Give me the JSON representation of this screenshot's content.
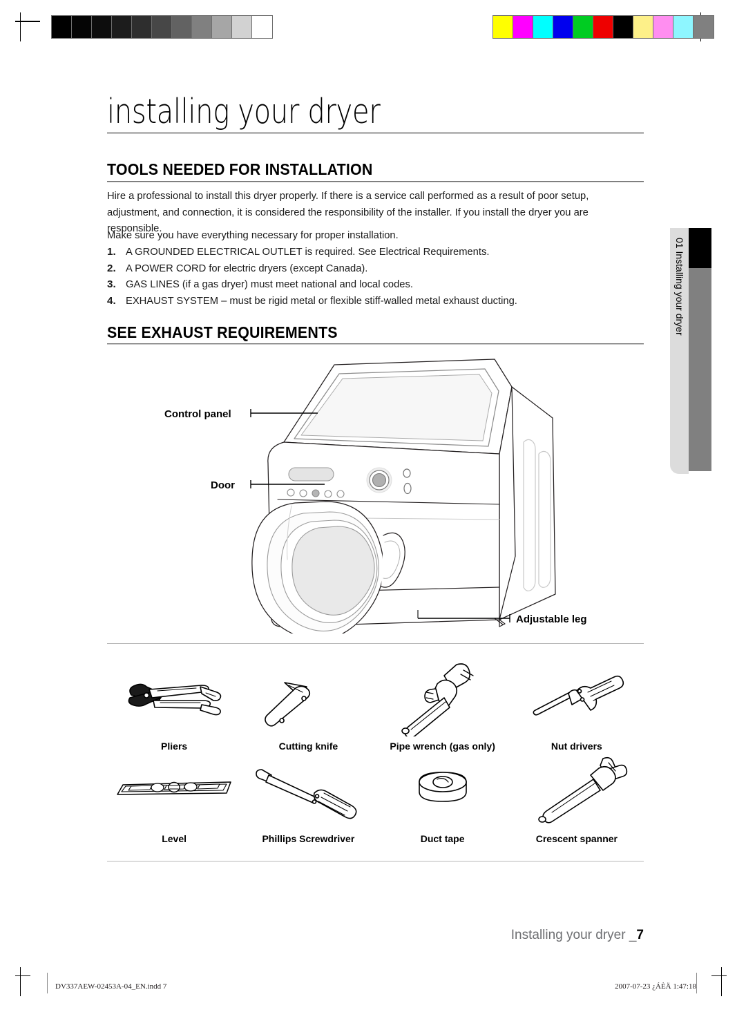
{
  "document": {
    "title": "installing your dryer"
  },
  "calibration": {
    "grayscale_label": "grayscale-calibration-bar",
    "grayscale_swatches": [
      "#000000",
      "#050505",
      "#0d0d0d",
      "#1c1c1c",
      "#2e2e2e",
      "#474747",
      "#626262",
      "#808080",
      "#a6a6a6",
      "#d2d2d2",
      "#ffffff"
    ],
    "color_label": "color-calibration-bar",
    "color_swatches": [
      "#ffff00",
      "#ff00ff",
      "#00ffff",
      "#0000ee",
      "#00cc22",
      "#ee0000",
      "#000000",
      "#fdf089",
      "#ff8ef0",
      "#8ef6ff",
      "#808080"
    ]
  },
  "sections": [
    {
      "id": "tools-needed",
      "heading": "TOOLS NEEDED FOR INSTALLATION",
      "paragraphs": [
        "Hire a professional to install this dryer properly. If there is a service call performed as a result of poor setup, adjustment, and connection, it is considered the responsibility of the installer. If you install the dryer you are responsible.",
        "Make sure you have everything necessary for proper installation."
      ],
      "list": [
        {
          "number": "1.",
          "text": "A GROUNDED ELECTRICAL OUTLET is required. See Electrical Requirements."
        },
        {
          "number": "2.",
          "text": "A POWER CORD for electric dryers (except Canada)."
        },
        {
          "number": "3.",
          "text": "GAS LINES (if a gas dryer) must meet national and local codes."
        },
        {
          "number": "4.",
          "text": "EXHAUST SYSTEM – must be rigid metal or flexible stiff-walled metal exhaust ducting."
        }
      ]
    },
    {
      "id": "see-exhaust-requirements",
      "heading": "SEE EXHAUST REQUIREMENTS"
    }
  ],
  "side_tab": {
    "label": "01 Installing your dryer",
    "black_color": "#000000",
    "gray_color": "#808080",
    "light_color": "#dcdcdc"
  },
  "figure": {
    "name": "front-load-dryer-diagram",
    "callouts": [
      {
        "id": "control-panel",
        "label": "Control panel"
      },
      {
        "id": "door",
        "label": "Door"
      },
      {
        "id": "adjustable-leg",
        "label": "Adjustable leg"
      }
    ]
  },
  "tools": [
    {
      "id": "pliers",
      "label": "Pliers"
    },
    {
      "id": "cutting-knife",
      "label": "Cutting knife"
    },
    {
      "id": "pipe-wrench",
      "label": "Pipe wrench (gas only)"
    },
    {
      "id": "nut-drivers",
      "label": "Nut drivers"
    },
    {
      "id": "level",
      "label": "Level"
    },
    {
      "id": "phillips-screwdriver",
      "label": "Phillips Screwdriver"
    },
    {
      "id": "duct-tape",
      "label": "Duct tape"
    },
    {
      "id": "crescent-spanner",
      "label": "Crescent spanner"
    }
  ],
  "footer": {
    "running_title": "Installing your dryer _",
    "page_number": "7",
    "print_file": "DV337AEW-02453A-04_EN.indd   7",
    "print_timestamp": "2007-07-23   ¿ÁÈÄ 1:47:18"
  }
}
